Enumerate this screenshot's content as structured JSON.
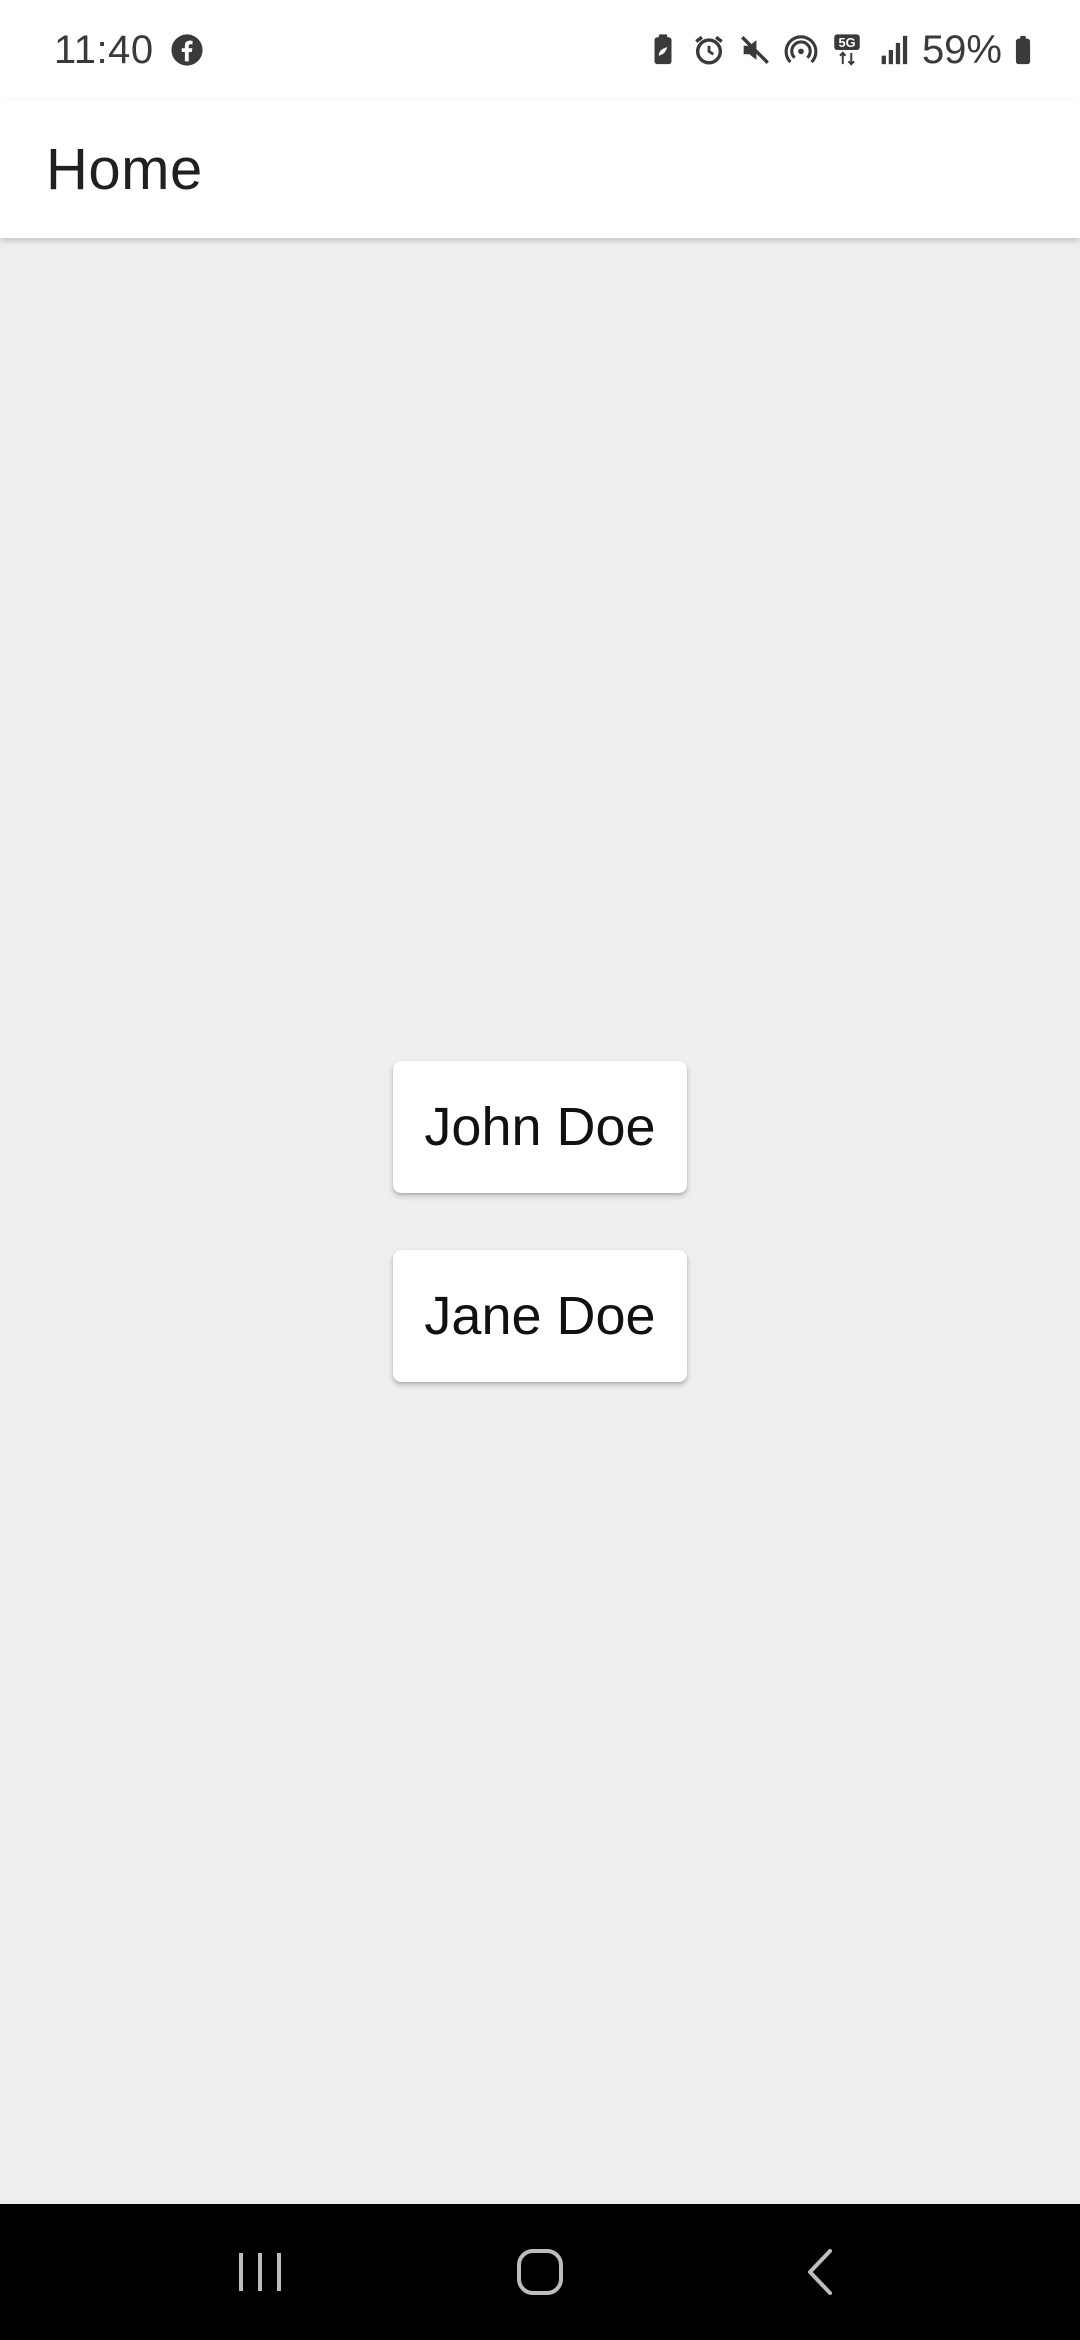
{
  "status_bar": {
    "time": "11:40",
    "battery_percent": "59%",
    "icons": [
      "facebook-icon",
      "battery-saver-icon",
      "alarm-icon",
      "mute-icon",
      "hotspot-icon",
      "5g-icon",
      "signal-icon",
      "battery-icon"
    ]
  },
  "app_bar": {
    "title": "Home"
  },
  "people": [
    {
      "label": "John Doe"
    },
    {
      "label": "Jane Doe"
    }
  ],
  "nav_bar": {
    "icons": [
      "recent-apps-icon",
      "home-icon",
      "back-icon"
    ]
  },
  "colors": {
    "background": "#efefef",
    "app_bar": "#ffffff",
    "nav_bar": "#000000",
    "text": "#202020"
  }
}
